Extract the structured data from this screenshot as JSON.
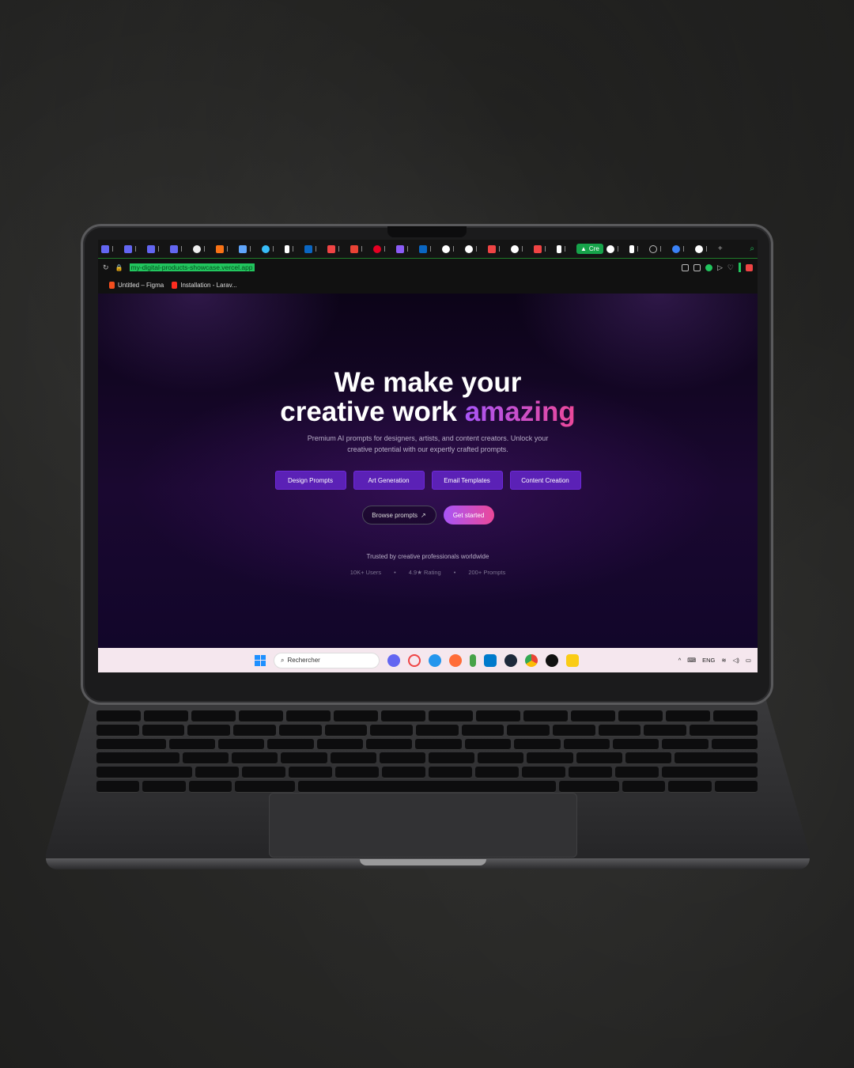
{
  "browser": {
    "active_tab_label": "Cre",
    "url": "my-digital-products-showcase.vercel.app",
    "bookmarks": [
      {
        "label": "Untitled – Figma",
        "icon": "figma-icon",
        "color": "#f24e1e"
      },
      {
        "label": "Installation - Larav...",
        "icon": "laravel-icon",
        "color": "#ff2d20"
      }
    ]
  },
  "hero": {
    "title_line1": "We make your",
    "title_line2_plain": "creative work",
    "title_line2_accent": "amazing",
    "subtitle_line1": "Premium AI prompts for designers, artists, and content creators. Unlock your",
    "subtitle_line2": "creative potential with our expertly crafted prompts."
  },
  "categories": [
    {
      "label": "Design Prompts"
    },
    {
      "label": "Art Generation"
    },
    {
      "label": "Email Templates"
    },
    {
      "label": "Content Creation"
    }
  ],
  "cta": {
    "browse_label": "Browse prompts",
    "get_started_label": "Get started"
  },
  "trust": {
    "heading": "Trusted by creative professionals worldwide",
    "stats": [
      "10K+ Users",
      "4.9★ Rating",
      "200+ Prompts"
    ],
    "separator": "•"
  },
  "taskbar": {
    "search_placeholder": "Rechercher",
    "language": "ENG"
  },
  "colors": {
    "accent_purple": "#a855f7",
    "accent_pink": "#ec4899",
    "category_button": "#5b21b6",
    "active_tab": "#16a34a"
  }
}
